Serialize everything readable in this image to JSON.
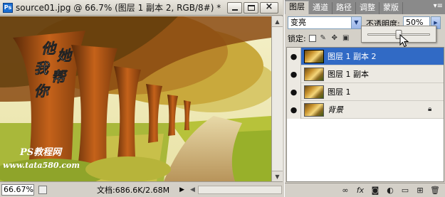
{
  "document": {
    "title": "source01.jpg @ 66.7% (图层 1 副本 2, RGB/8#) *",
    "app_badge": "Ps",
    "zoom": "66.67%",
    "doc_size": "文档:686.6K/2.68M"
  },
  "photo_overlay": {
    "calligraphy": [
      "他",
      "她",
      "我",
      "帮",
      "你"
    ],
    "watermark_line1": "PS教程网",
    "watermark_line2": "www.tata580.com"
  },
  "panel": {
    "tabs": [
      "图层",
      "通道",
      "路径",
      "调整",
      "蒙版"
    ],
    "active_tab": 0,
    "blend_mode": "变亮",
    "opacity_label": "不透明度:",
    "opacity_value": "50%",
    "opacity_fraction": 0.5,
    "lock_label": "锁定:",
    "layers": [
      {
        "name": "图层 1 副本 2",
        "selected": true,
        "locked": false,
        "italic": false
      },
      {
        "name": "图层 1 副本",
        "selected": false,
        "locked": false,
        "italic": false
      },
      {
        "name": "图层 1",
        "selected": false,
        "locked": false,
        "italic": false
      },
      {
        "name": "背景",
        "selected": false,
        "locked": true,
        "italic": true
      }
    ],
    "footer_icons": [
      "link-icon",
      "fx-icon",
      "mask-icon",
      "adjustment-icon",
      "group-icon",
      "new-layer-icon",
      "trash-icon"
    ]
  },
  "colors": {
    "selection": "#316ac5",
    "panel_bg": "#d4d0c8"
  }
}
